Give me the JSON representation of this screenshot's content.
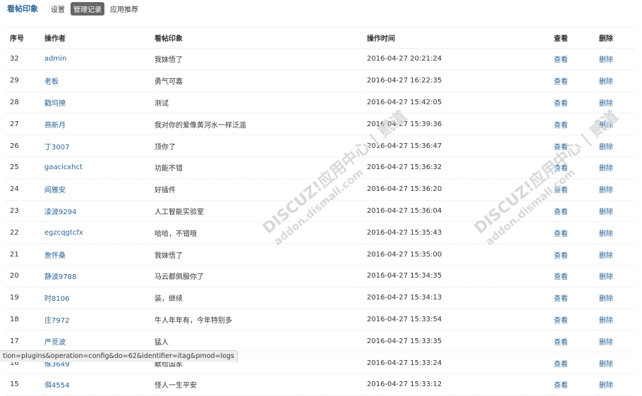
{
  "header": {
    "title": "看帖印象",
    "tabs": [
      {
        "label": "设置",
        "active": false
      },
      {
        "label": "管理记录",
        "active": true
      },
      {
        "label": "应用推荐",
        "active": false
      }
    ]
  },
  "table": {
    "columns": [
      "序号",
      "操作者",
      "看帖印象",
      "操作时间",
      "查看",
      "删除"
    ],
    "rows": [
      {
        "id": "32",
        "user": "admin",
        "impression": "我妹悟了",
        "time": "2016-04-27 20:21:24",
        "view": "查看",
        "del": "删除"
      },
      {
        "id": "29",
        "user": "老板",
        "impression": "勇气可嘉",
        "time": "2016-04-27 16:22:35",
        "view": "查看",
        "del": "删除"
      },
      {
        "id": "28",
        "user": "戳坞撩",
        "impression": "测试",
        "time": "2016-04-27 15:42:05",
        "view": "查看",
        "del": "删除"
      },
      {
        "id": "27",
        "user": "燕新月",
        "impression": "我对你的爱像黄河水一样泛滥",
        "time": "2016-04-27 15:39:36",
        "view": "查看",
        "del": "删除"
      },
      {
        "id": "26",
        "user": "丁3007",
        "impression": "顶你了",
        "time": "2016-04-27 15:36:47",
        "view": "查看",
        "del": "删除"
      },
      {
        "id": "25",
        "user": "gaacicxhct",
        "impression": "功能不错",
        "time": "2016-04-27 15:36:32",
        "view": "查看",
        "del": "删除"
      },
      {
        "id": "24",
        "user": "阎雅安",
        "impression": "好插件",
        "time": "2016-04-27 15:36:20",
        "view": "查看",
        "del": "删除"
      },
      {
        "id": "23",
        "user": "凌波9294",
        "impression": "人工智能实验室",
        "time": "2016-04-27 15:36:04",
        "view": "查看",
        "del": "删除"
      },
      {
        "id": "22",
        "user": "egzcqgtcfx",
        "impression": "哈哈，不错哦",
        "time": "2016-04-27 15:35:43",
        "view": "查看",
        "del": "删除"
      },
      {
        "id": "21",
        "user": "詹怀桑",
        "impression": "我妹悟了",
        "time": "2016-04-27 15:35:00",
        "view": "查看",
        "del": "删除"
      },
      {
        "id": "20",
        "user": "静波9788",
        "impression": "马云都佩服你了",
        "time": "2016-04-27 15:34:35",
        "view": "查看",
        "del": "删除"
      },
      {
        "id": "19",
        "user": "时8106",
        "impression": "装，继续",
        "time": "2016-04-27 15:34:13",
        "view": "查看",
        "del": "删除"
      },
      {
        "id": "18",
        "user": "庄7972",
        "impression": "牛人年年有，今年特别多",
        "time": "2016-04-27 15:33:54",
        "view": "查看",
        "del": "删除"
      },
      {
        "id": "17",
        "user": "严觅波",
        "impression": "猛人",
        "time": "2016-04-27 15:33:35",
        "view": "查看",
        "del": "删除"
      },
      {
        "id": "16",
        "user": "缑3649",
        "impression": "献给国家",
        "time": "2016-04-27 15:33:24",
        "view": "查看",
        "del": "删除"
      },
      {
        "id": "15",
        "user": "佴4554",
        "impression": "怪人一生平安",
        "time": "2016-04-27 15:33:12",
        "view": "查看",
        "del": "删除"
      }
    ]
  },
  "statusbar": {
    "url": "tion=plugins&operation=config&do=62&identifier=itag&pmod=logs"
  },
  "watermark": {
    "line1": "DISCUZ!应用中心 | 贰道",
    "line2": "addon.dismall.com"
  }
}
